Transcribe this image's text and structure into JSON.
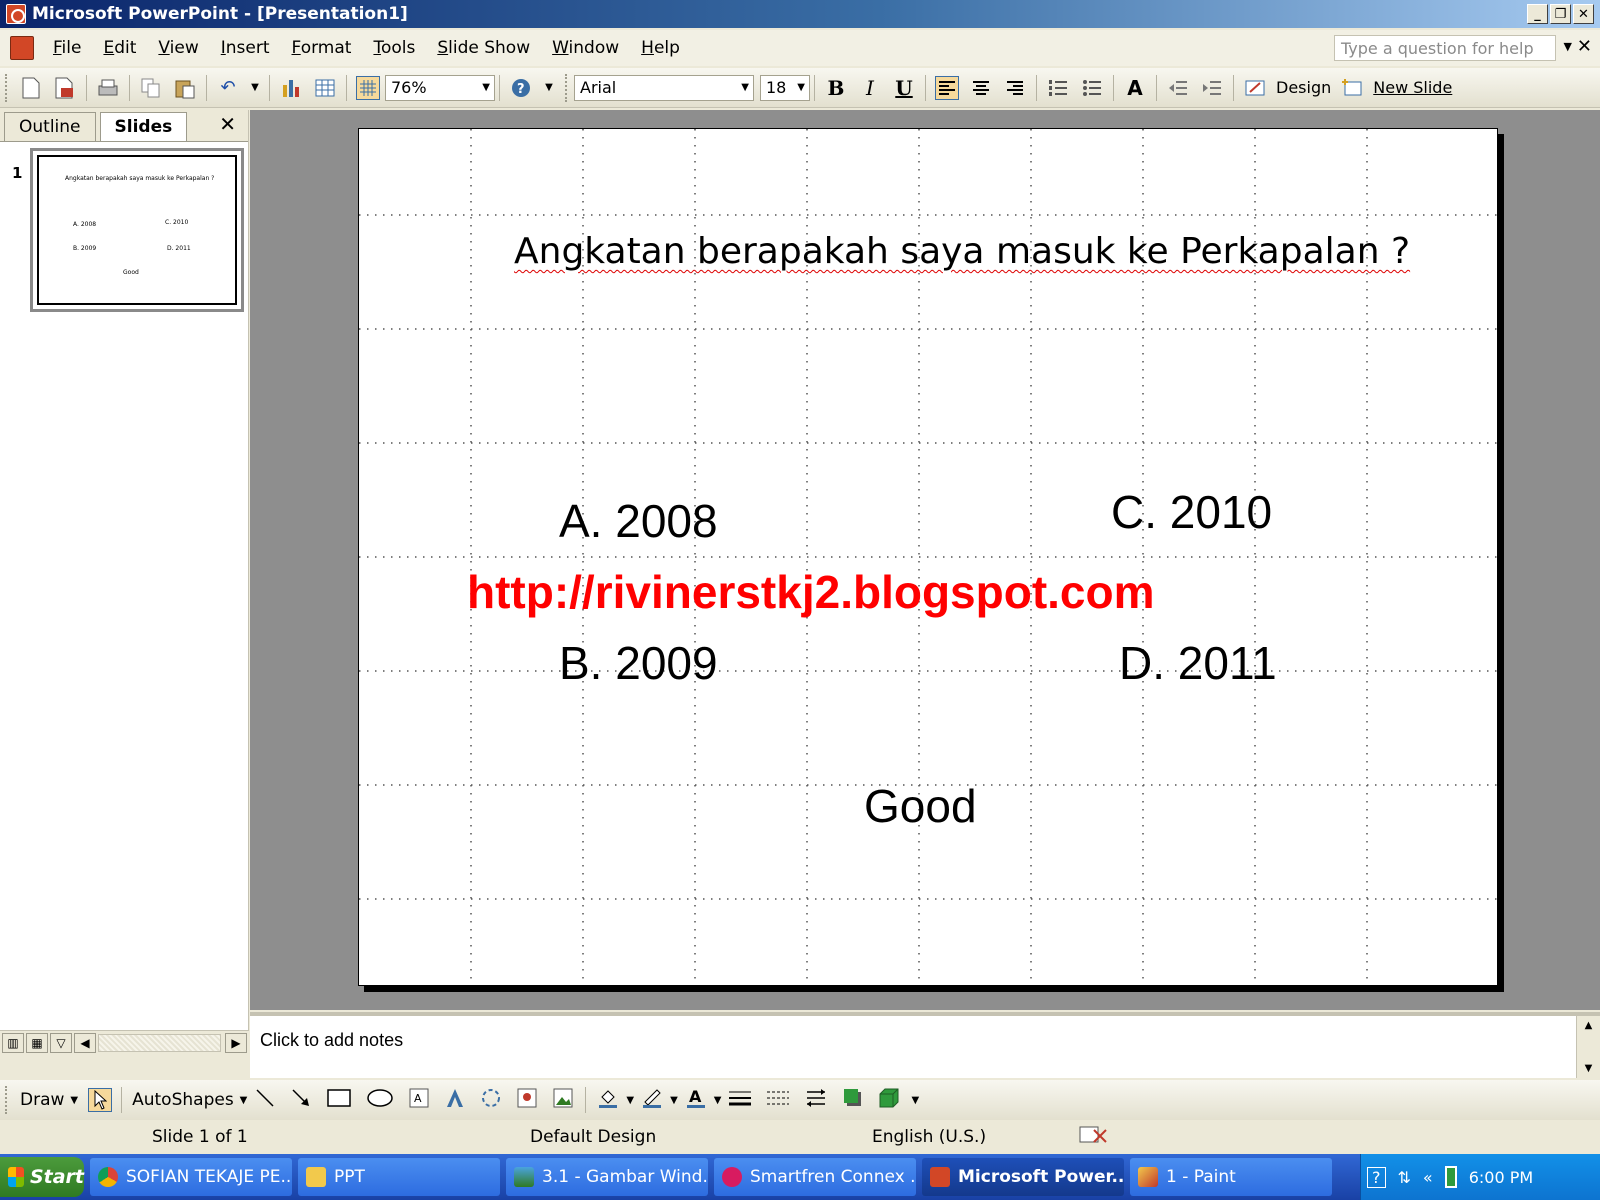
{
  "window": {
    "title": "Microsoft PowerPoint - [Presentation1]",
    "controls": [
      "_",
      "❐",
      "✕"
    ]
  },
  "menu": {
    "items": [
      "File",
      "Edit",
      "View",
      "Insert",
      "Format",
      "Tools",
      "Slide Show",
      "Window",
      "Help"
    ],
    "help_placeholder": "Type a question for help",
    "close_glyph": "✕"
  },
  "toolbar": {
    "zoom": "76%",
    "font_name": "Arial",
    "font_size": "18",
    "bold": "B",
    "italic": "I",
    "underline": "U",
    "design_label": "Design",
    "new_slide_label": "New Slide"
  },
  "left_pane": {
    "tabs": [
      "Outline",
      "Slides"
    ],
    "active_tab": "Slides",
    "close_glyph": "✕",
    "slide_number": "1"
  },
  "slide": {
    "question": "Angkatan berapakah saya masuk ke Perkapalan ?",
    "option_a": "A. 2008",
    "option_b": "B. 2009",
    "option_c": "C. 2010",
    "option_d": "D. 2011",
    "good": "Good",
    "watermark": "http://rivinerstkj2.blogspot.com",
    "watermark_color": "#ff0000"
  },
  "notes": {
    "placeholder": "Click to add notes"
  },
  "drawing_toolbar": {
    "draw_label": "Draw",
    "autoshapes_label": "AutoShapes"
  },
  "status": {
    "slide_pos": "Slide 1 of 1",
    "design": "Default Design",
    "language": "English (U.S.)"
  },
  "taskbar": {
    "start_label": "Start",
    "tasks": [
      {
        "label": "SOFIAN TEKAJE PE...",
        "icon": "chrome-icon"
      },
      {
        "label": "PPT",
        "icon": "folder-icon"
      },
      {
        "label": "3.1 - Gambar Wind...",
        "icon": "image-icon"
      },
      {
        "label": "Smartfren Connex ...",
        "icon": "smartfren-icon"
      },
      {
        "label": "Microsoft Power...",
        "icon": "powerpoint-icon"
      },
      {
        "label": "1 - Paint",
        "icon": "paint-icon"
      }
    ],
    "time": "6:00 PM"
  }
}
